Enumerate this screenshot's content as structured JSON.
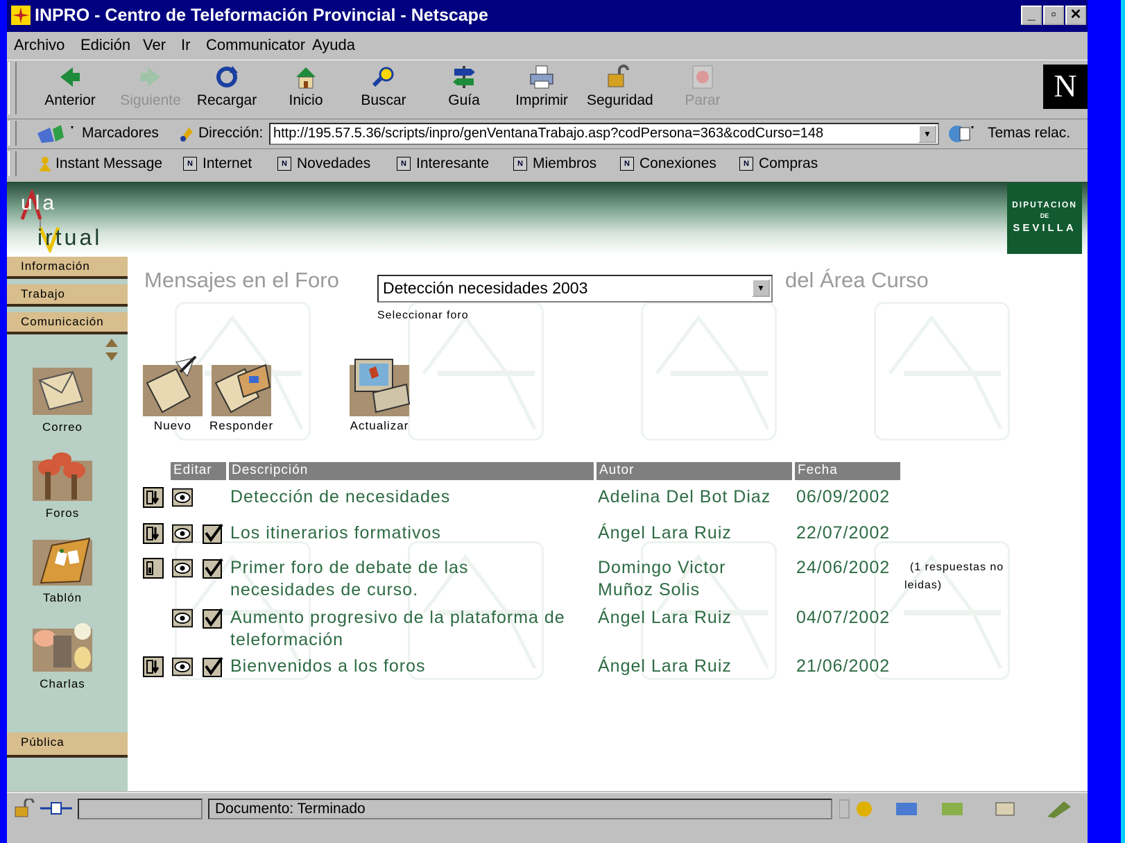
{
  "window": {
    "title": "INPRO - Centro de Teleformación Provincial - Netscape",
    "controls": [
      "_",
      "▫",
      "✕"
    ]
  },
  "menu": [
    "Archivo",
    "Edición",
    "Ver",
    "Ir",
    "Communicator",
    "Ayuda"
  ],
  "toolbar": {
    "buttons": [
      {
        "label": "Anterior",
        "icon": "back-arrow-icon",
        "enabled": true
      },
      {
        "label": "Siguiente",
        "icon": "forward-arrow-icon",
        "enabled": false
      },
      {
        "label": "Recargar",
        "icon": "reload-icon",
        "enabled": true
      },
      {
        "label": "Inicio",
        "icon": "home-icon",
        "enabled": true
      },
      {
        "label": "Buscar",
        "icon": "search-icon",
        "enabled": true
      },
      {
        "label": "Guía",
        "icon": "guide-icon",
        "enabled": true
      },
      {
        "label": "Imprimir",
        "icon": "printer-icon",
        "enabled": true
      },
      {
        "label": "Seguridad",
        "icon": "lock-icon",
        "enabled": true
      },
      {
        "label": "Parar",
        "icon": "stop-icon",
        "enabled": false
      }
    ],
    "logo": "N"
  },
  "location": {
    "bookmarks_label": "Marcadores",
    "address_label": "Dirección:",
    "url": "http://195.57.5.36/scripts/inpro/genVentanaTrabajo.asp?codPersona=363&codCurso=148",
    "related_label": "Temas relac."
  },
  "personal_toolbar": [
    "Instant Message",
    "Internet",
    "Novedades",
    "Interesante",
    "Miembros",
    "Conexiones",
    "Compras"
  ],
  "banner": {
    "logo_line1": "ula",
    "logo_line2": "irtual",
    "seal_top": "DIPUTACION",
    "seal_mid": "DE",
    "seal_bottom": "SEVILLA"
  },
  "nav": {
    "tabs": [
      "Información",
      "Trabajo",
      "Comunicación"
    ],
    "items": [
      {
        "label": "Correo",
        "icon": "mail-icon"
      },
      {
        "label": "Foros",
        "icon": "forum-icon"
      },
      {
        "label": "Tablón",
        "icon": "board-icon"
      },
      {
        "label": "Charlas",
        "icon": "chat-icon"
      }
    ],
    "bottom_tab": "Pública"
  },
  "forum": {
    "title_prefix": "Mensajes en el Foro",
    "selected_forum": "Detección necesidades 2003",
    "title_suffix": "del Área Curso",
    "select_hint": "Seleccionar foro",
    "actions": [
      "Nuevo",
      "Responder",
      "Actualizar"
    ],
    "columns": [
      "Editar",
      "Descripción",
      "Autor",
      "Fecha"
    ],
    "rows": [
      {
        "desc": "Detección de necesidades",
        "author": "Adelina Del Bot Diaz",
        "date": "06/09/2002",
        "note": ""
      },
      {
        "desc": "Los itinerarios formativos",
        "author": "Ángel Lara Ruiz",
        "date": "22/07/2002",
        "note": ""
      },
      {
        "desc1": "Primer foro de debate de las",
        "desc2": "necesidades de curso.",
        "author1": "Domingo Victor",
        "author2": "Muñoz Solis",
        "date": "24/06/2002",
        "note1": "(1 respuestas no",
        "note2": "leidas)"
      },
      {
        "desc1": "Aumento progresivo de la plataforma de",
        "desc2": "teleformación",
        "author": "Ángel Lara Ruiz",
        "date": "04/07/2002"
      },
      {
        "desc": "Bienvenidos a los foros",
        "author": "Ángel Lara Ruiz",
        "date": "21/06/2002"
      }
    ]
  },
  "status": {
    "text": "Documento: Terminado"
  },
  "colors": {
    "link_green": "#2d6b43",
    "nav_tan": "#d8bd8d",
    "sidebar": "#b7cfc4",
    "title_blue": "#000080"
  }
}
